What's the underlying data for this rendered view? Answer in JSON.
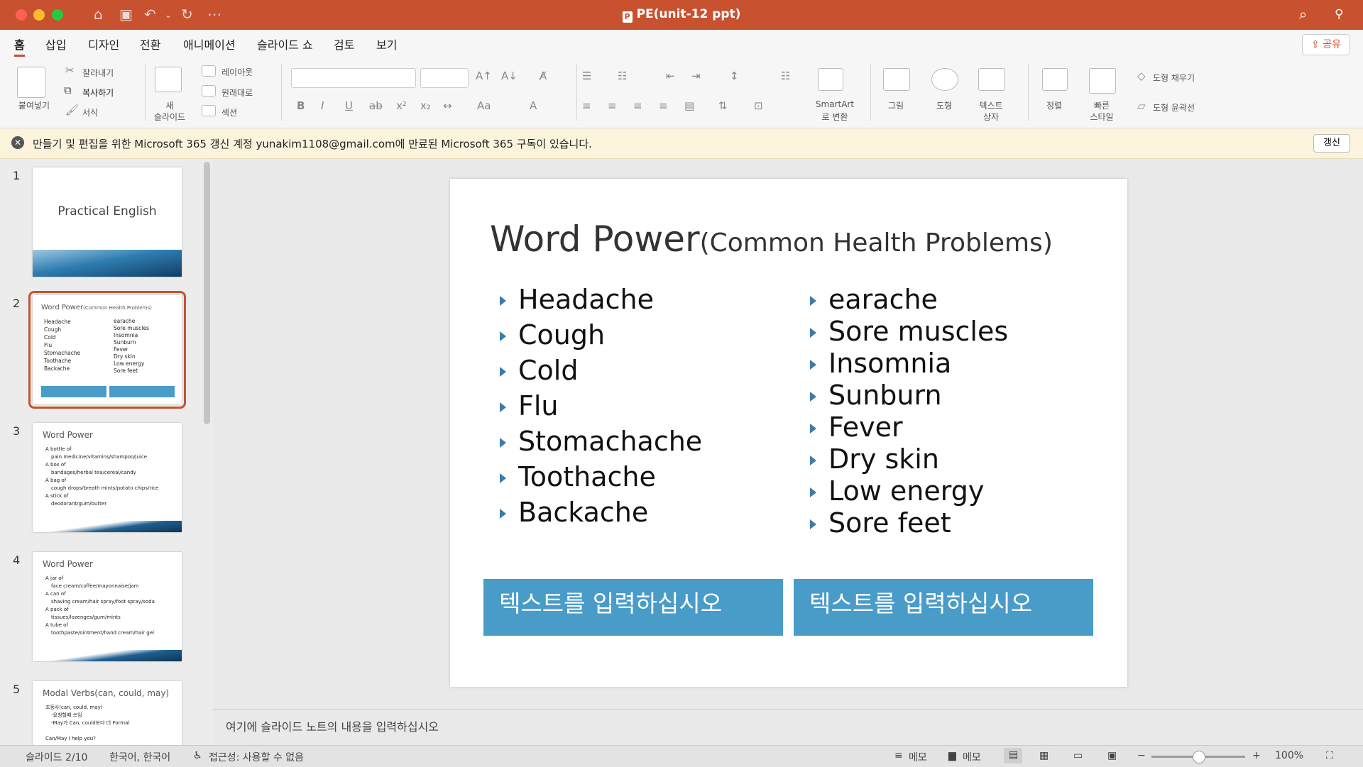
{
  "window": {
    "title": "PE(unit-12 ppt)"
  },
  "tabs": [
    "홈",
    "삽입",
    "디자인",
    "전환",
    "애니메이션",
    "슬라이드 쇼",
    "검토",
    "보기"
  ],
  "share_label": "공유",
  "ribbon": {
    "paste": "붙여넣기",
    "cut": "잘라내기",
    "copy": "복사하기",
    "format": "서식",
    "new_slide_1": "새",
    "new_slide_2": "슬라이드",
    "layout": "레이아웃",
    "reset": "원래대로",
    "section": "섹션",
    "smartart_1": "SmartArt",
    "smartart_2": "로 변환",
    "picture": "그림",
    "shapes": "도형",
    "textbox_1": "텍스트",
    "textbox_2": "상자",
    "arrange": "정렬",
    "quick_1": "빠른",
    "quick_2": "스타일",
    "shape_fill": "도형 채우기",
    "shape_outline": "도형 윤곽선"
  },
  "notice": {
    "text": "만들기 및 편집을 위한 Microsoft 365 갱신  계정 yunakim1108@gmail.com에 만료된 Microsoft 365 구독이 있습니다.",
    "button": "갱신"
  },
  "thumbnails": [
    {
      "num": "1",
      "title": "Practical English"
    },
    {
      "num": "2",
      "title": "Word Power",
      "subtitle": "(Common Health Problems)",
      "left": [
        "Headache",
        "Cough",
        "Cold",
        "Flu",
        "Stomachache",
        "Toothache",
        "Backache"
      ],
      "right": [
        "earache",
        "Sore muscles",
        "Insomnia",
        "Sunburn",
        "Fever",
        "Dry skin",
        "Low energy",
        "Sore feet"
      ]
    },
    {
      "num": "3",
      "title": "Word Power",
      "lines": [
        "A bottle of",
        "pain medicine/vitamins/shampoo/juice",
        "A box of",
        "bandages/herbal tea/cereal/candy",
        "A bag of",
        "cough drops/breath mints/potato chips/rice",
        "A stick of",
        "deodorant/gum/butter"
      ]
    },
    {
      "num": "4",
      "title": "Word Power",
      "lines": [
        "A jar of",
        "face cream/coffee/mayonnaise/jam",
        "A can of",
        "shaving cream/hair spray/foot spray/soda",
        "A pack of",
        "tissues/lozenges/gum/mints",
        "A tube of",
        "toothpaste/ointment/hand cream/hair gel"
      ]
    },
    {
      "num": "5",
      "title": "Modal Verbs(can, could, may)",
      "lines": [
        "조동사(can, could, may)",
        "-요청할때 쓰임",
        "-May가 Can, could보다 더 Formal",
        "",
        "Can/May I help you?"
      ]
    }
  ],
  "slide": {
    "title": "Word Power",
    "subtitle": "(Common Health Problems)",
    "left_items": [
      "Headache",
      "Cough",
      "Cold",
      "Flu",
      "Stomachache",
      "Toothache",
      "Backache"
    ],
    "right_items": [
      "earache",
      "Sore muscles",
      "Insomnia",
      "Sunburn",
      "Fever",
      "Dry skin",
      "Low energy",
      "Sore feet"
    ],
    "box_left": "텍스트를 입력하십시오",
    "box_right": "텍스트를 입력하십시오"
  },
  "notes_placeholder": "여기에 슬라이드 노트의 내용을 입력하십시오",
  "status": {
    "slide": "슬라이드 2/10",
    "language": "한국어, 한국어",
    "accessibility": "접근성: 사용할 수 없음",
    "notes": "메모",
    "comments": "메모",
    "zoom": "100%"
  }
}
